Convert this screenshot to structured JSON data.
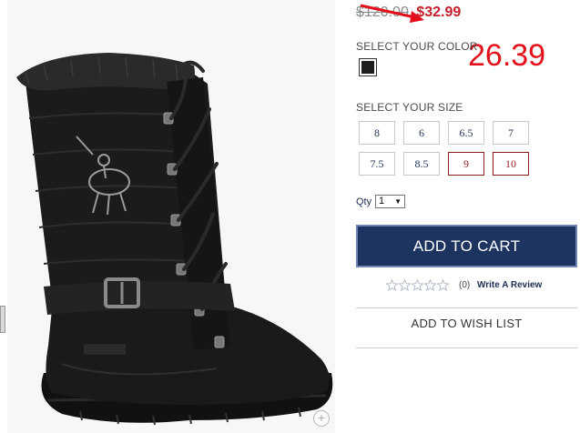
{
  "product": {
    "image_alt": "Black quilted lace-up winter boot with faux fur trim and buckle strap",
    "brand_emblem": "U.S. POLO ASSN."
  },
  "pricing": {
    "original_price": "$120.00",
    "sale_price": "$32.99"
  },
  "annotation": {
    "number": "26.39",
    "color": "#e3101b"
  },
  "color_section": {
    "label": "SELECT YOUR COLOR",
    "swatches": [
      {
        "name": "Black",
        "color": "#1e1e1e",
        "selected": true
      }
    ]
  },
  "size_section": {
    "label": "SELECT YOUR SIZE",
    "sizes": [
      {
        "label": "8",
        "available": true
      },
      {
        "label": "6",
        "available": true
      },
      {
        "label": "6.5",
        "available": true
      },
      {
        "label": "7",
        "available": true
      },
      {
        "label": "7.5",
        "available": true
      },
      {
        "label": "8.5",
        "available": true
      },
      {
        "label": "9",
        "available": false
      },
      {
        "label": "10",
        "available": false
      }
    ]
  },
  "quantity": {
    "label": "Qty",
    "value": "1"
  },
  "actions": {
    "add_to_cart": "ADD TO CART",
    "add_to_wish_list": "ADD TO WISH LIST"
  },
  "reviews": {
    "rating": 0,
    "max_rating": 5,
    "count_text": "(0)",
    "write_review": "Write A Review"
  },
  "colors": {
    "sale_red": "#c41f2b",
    "navy": "#1d3461",
    "unavailable": "#8c1c1c"
  }
}
